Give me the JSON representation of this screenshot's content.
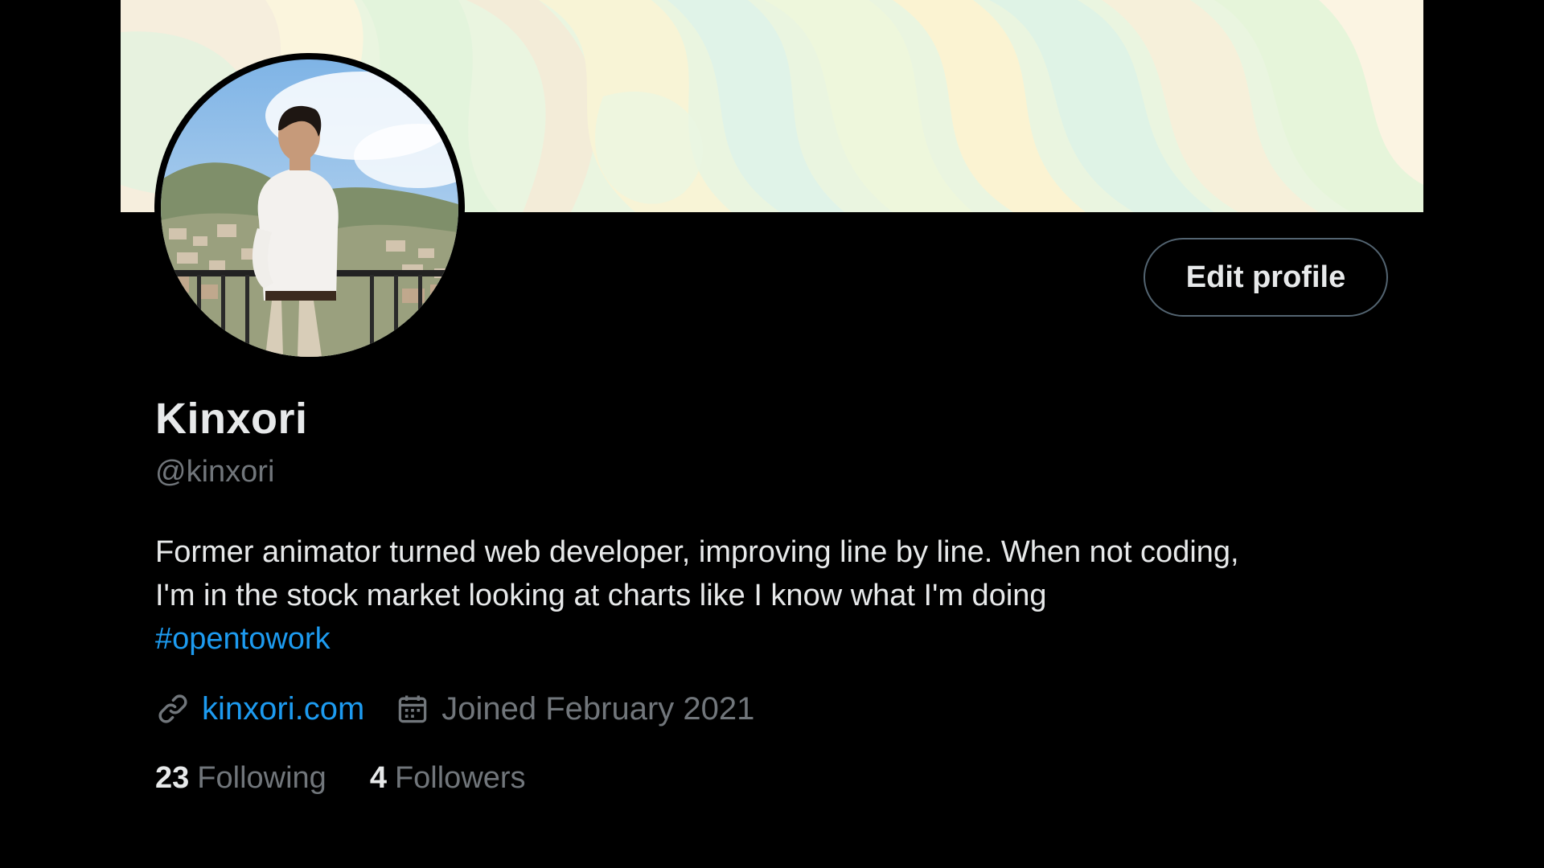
{
  "profile": {
    "display_name": "Kinxori",
    "handle": "@kinxori",
    "bio_lines": [
      "Former animator turned web developer, improving line by line. When not coding,",
      "I'm in the stock market looking at charts like I know what I'm doing"
    ],
    "hashtag": "#opentowork",
    "website": "kinxori.com",
    "joined": "Joined February 2021",
    "following_count": "23",
    "following_label": "Following",
    "followers_count": "4",
    "followers_label": "Followers"
  },
  "actions": {
    "edit_profile_label": "Edit profile"
  },
  "icons": {
    "website": "link-icon",
    "joined": "calendar-icon"
  },
  "colors": {
    "background": "#000000",
    "text_primary": "#e7e9ea",
    "text_secondary": "#71767b",
    "accent": "#1d9bf0",
    "button_border": "#536471"
  }
}
